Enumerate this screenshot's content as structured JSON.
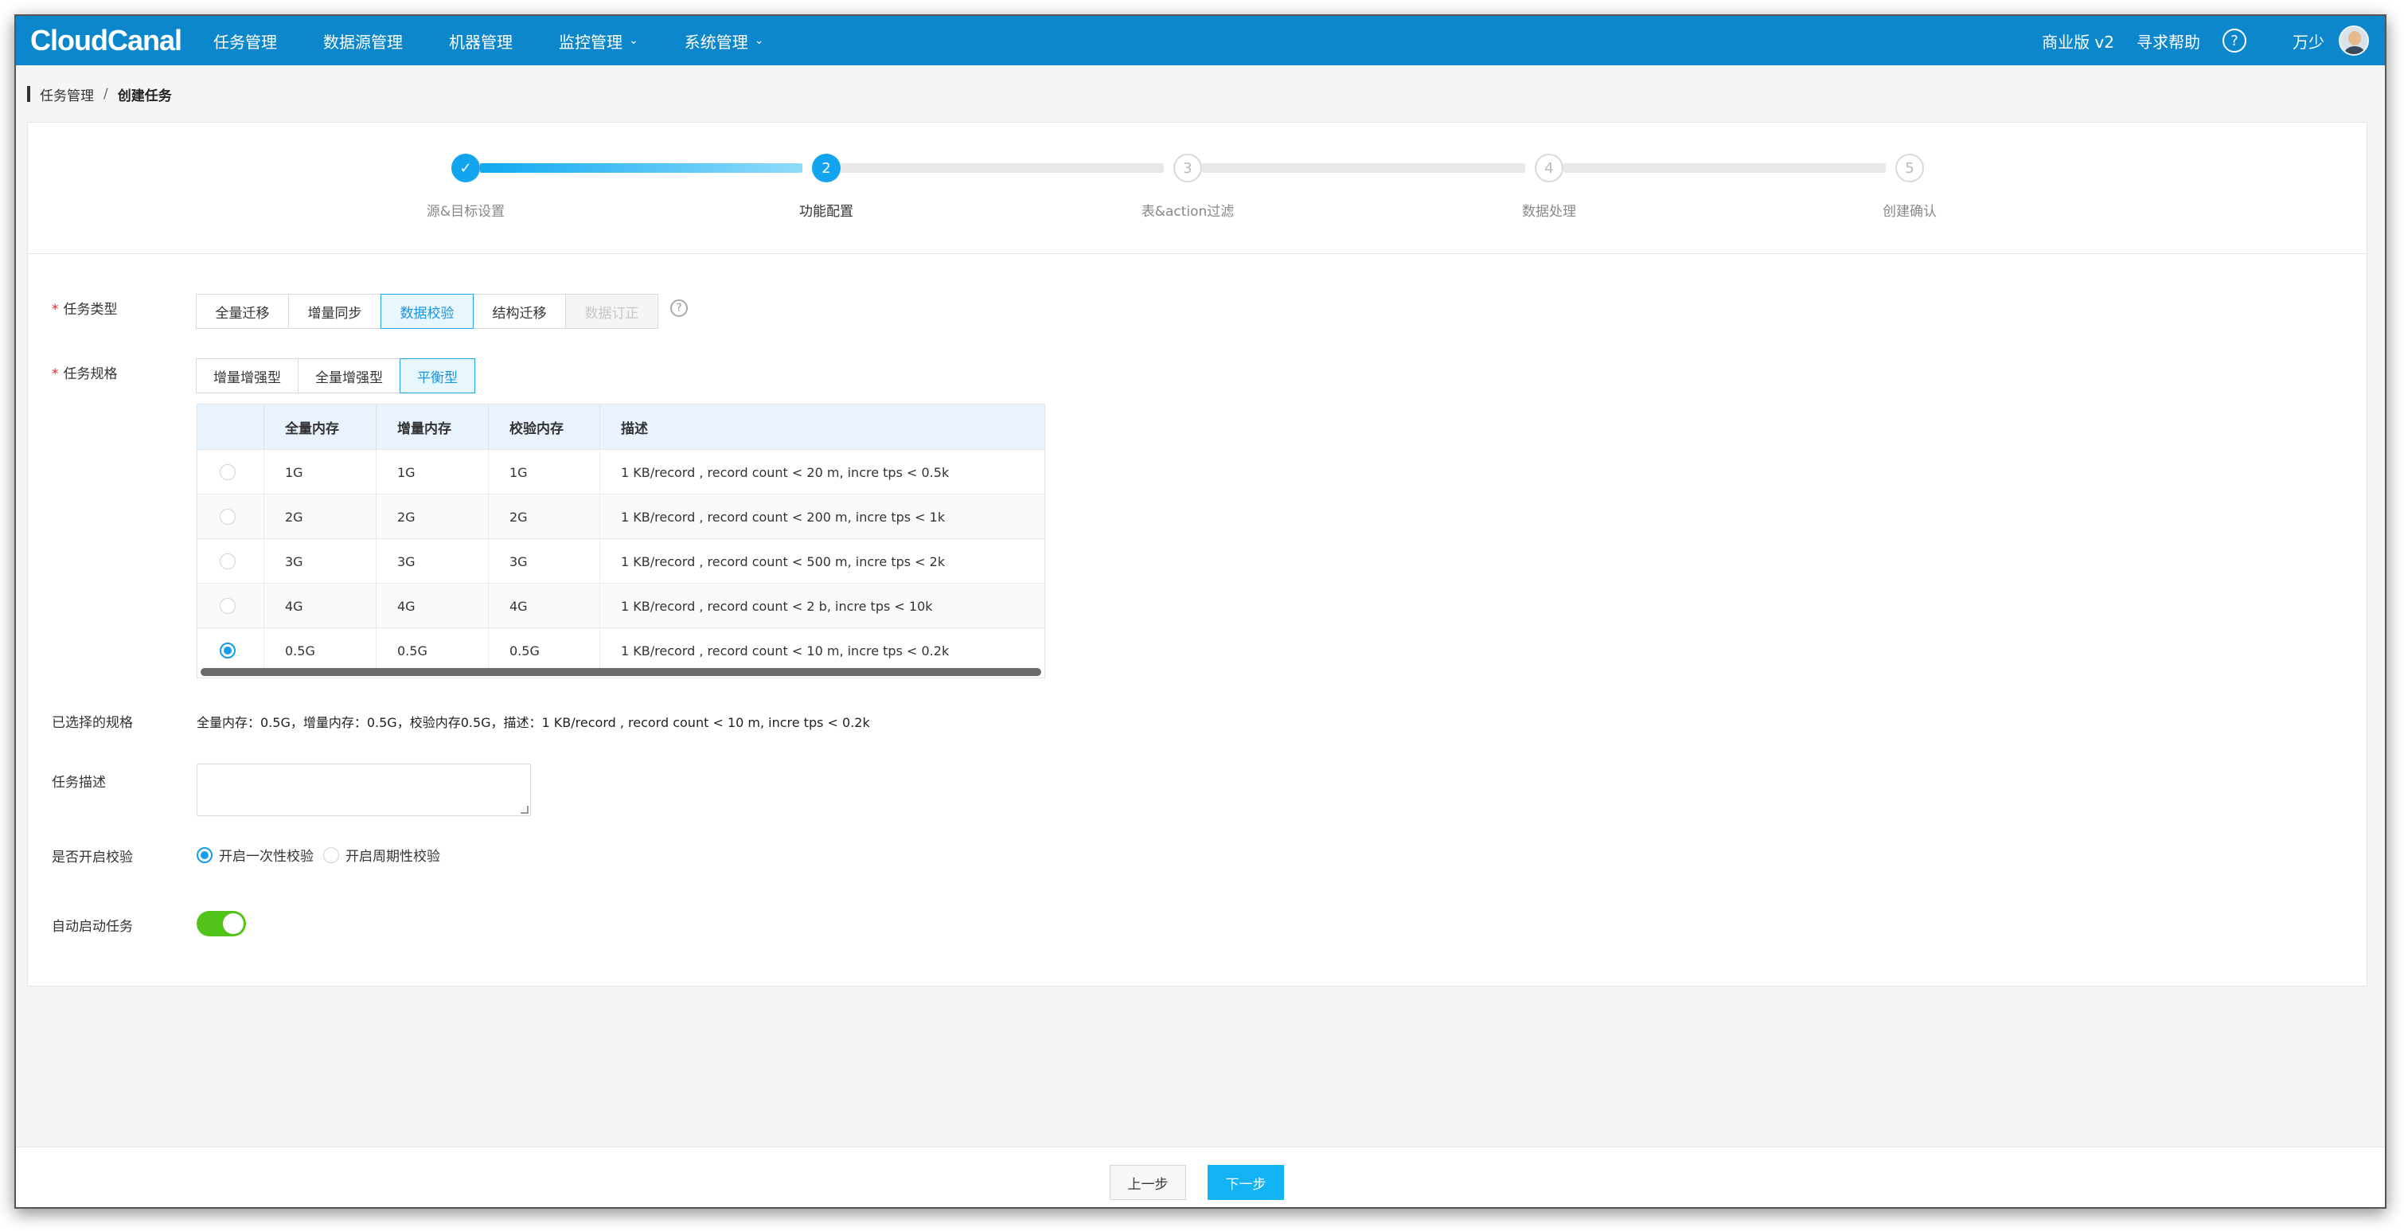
{
  "app": {
    "logo": "CloudCanal"
  },
  "nav": {
    "items": [
      {
        "label": "任务管理",
        "dropdown": false
      },
      {
        "label": "数据源管理",
        "dropdown": false
      },
      {
        "label": "机器管理",
        "dropdown": false
      },
      {
        "label": "监控管理",
        "dropdown": true
      },
      {
        "label": "系统管理",
        "dropdown": true
      }
    ]
  },
  "header_right": {
    "edition": "商业版 v2",
    "help": "寻求帮助",
    "help_icon": "?",
    "user": "万少"
  },
  "breadcrumb": {
    "parent": "任务管理",
    "separator": "/",
    "current": "创建任务"
  },
  "steps": [
    {
      "label": "源&目标设置",
      "marker": "✓",
      "state": "done"
    },
    {
      "label": "功能配置",
      "marker": "2",
      "state": "active"
    },
    {
      "label": "表&action过滤",
      "marker": "3",
      "state": "todo"
    },
    {
      "label": "数据处理",
      "marker": "4",
      "state": "todo"
    },
    {
      "label": "创建确认",
      "marker": "5",
      "state": "todo"
    }
  ],
  "form": {
    "task_type": {
      "label": "任务类型",
      "required_mark": "*",
      "options": [
        "全量迁移",
        "增量同步",
        "数据校验",
        "结构迁移",
        "数据订正"
      ],
      "selected": "数据校验",
      "disabled": "数据订正",
      "help_icon": "?"
    },
    "task_spec": {
      "label": "任务规格",
      "required_mark": "*",
      "options": [
        "增量增强型",
        "全量增强型",
        "平衡型"
      ],
      "selected": "平衡型"
    },
    "spec_table": {
      "columns": [
        "全量内存",
        "增量内存",
        "校验内存",
        "描述"
      ],
      "rows": [
        {
          "full": "1G",
          "incr": "1G",
          "check": "1G",
          "desc": "1 KB/record , record count < 20 m, incre tps < 0.5k",
          "selected": false
        },
        {
          "full": "2G",
          "incr": "2G",
          "check": "2G",
          "desc": "1 KB/record , record count < 200 m, incre tps < 1k",
          "selected": false
        },
        {
          "full": "3G",
          "incr": "3G",
          "check": "3G",
          "desc": "1 KB/record , record count < 500 m, incre tps < 2k",
          "selected": false
        },
        {
          "full": "4G",
          "incr": "4G",
          "check": "4G",
          "desc": "1 KB/record , record count < 2 b, incre tps < 10k",
          "selected": false
        },
        {
          "full": "0.5G",
          "incr": "0.5G",
          "check": "0.5G",
          "desc": "1 KB/record , record count < 10 m, incre tps < 0.2k",
          "selected": true
        }
      ]
    },
    "selected_spec": {
      "label": "已选择的规格",
      "value": "全量内存：0.5G，增量内存：0.5G，校验内存0.5G，描述：1 KB/record , record count < 10 m, incre tps < 0.2k"
    },
    "description": {
      "label": "任务描述",
      "value": ""
    },
    "check": {
      "label": "是否开启校验",
      "options": [
        "开启一次性校验",
        "开启周期性校验"
      ],
      "selected": "开启一次性校验"
    },
    "auto_start": {
      "label": "自动启动任务",
      "on": true
    }
  },
  "footer": {
    "prev": "上一步",
    "next": "下一步"
  },
  "colors": {
    "topbar": "#0c87cc",
    "accent": "#13a4f0",
    "toggle_on": "#52c41a",
    "required": "#f5222d"
  }
}
